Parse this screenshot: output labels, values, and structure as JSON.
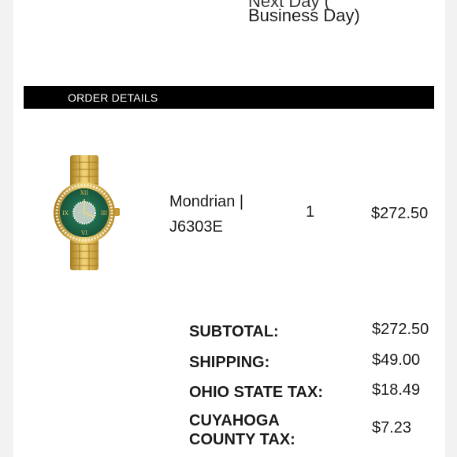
{
  "delivery": {
    "line1": "Next Day (",
    "line2": "Business Day)"
  },
  "order_details": {
    "header": "ORDER DETAILS",
    "item": {
      "image": "gold-watch-green-dial",
      "name_line1": "Mondrian |",
      "name_line2": "J6303E",
      "quantity": "1",
      "price": "$272.50"
    }
  },
  "totals": {
    "subtotal_label": "SUBTOTAL:",
    "subtotal_value": "$272.50",
    "shipping_label": "SHIPPING:",
    "shipping_value": "$49.00",
    "state_tax_label": "OHIO STATE TAX:",
    "state_tax_value": "$18.49",
    "county_tax_label_line1": "CUYAHOGA",
    "county_tax_label_line2": "COUNTY TAX:",
    "county_tax_value": "$7.23"
  },
  "colors": {
    "banner": "#000000",
    "banner_text": "#ffffff",
    "gold": "#d4a838",
    "dial_green": "#1f6b4d"
  }
}
